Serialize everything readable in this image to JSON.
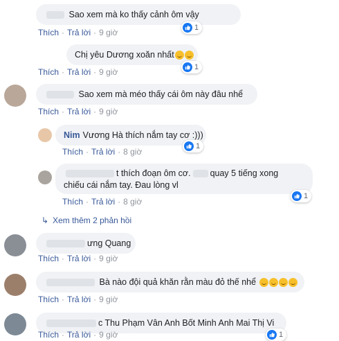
{
  "actions": {
    "like": "Thích",
    "reply": "Trả lời",
    "dot": "·"
  },
  "comments": [
    {
      "text": "Sao xem mà ko thấy cảnh ôm vậy",
      "time": "9 giờ",
      "reactions": "1"
    },
    {
      "text": "Chị yêu Dương xoăn nhất",
      "time": "9 giờ",
      "reactions": "1"
    },
    {
      "text": "Sao xem mà méo thấy cái ôm này đâu nhể",
      "time": "9 giờ",
      "reactions": ""
    },
    {
      "name": "Nim",
      "text": "Vương Hà thích nắm tay cơ :)))",
      "time": "8 giờ",
      "reactions": "1"
    },
    {
      "text_a": "t thích đoạn ôm cơ.",
      "text_b": "quay 5 tiếng xong",
      "text_c": "chiếu cái nắm tay. Đau lòng vl",
      "time": "8 giờ",
      "reactions": "1"
    },
    {
      "text": "ưng Quang",
      "time": "9 giờ",
      "reactions": ""
    },
    {
      "text": "Bà nào đội quả khăn rằn màu đỏ thế nhể",
      "time": "9 giờ",
      "reactions": ""
    },
    {
      "text": "c Thu Phạm Vân Anh Bốt Minh Anh Mai Thị Vi",
      "time": "9 giờ",
      "reactions": "1"
    }
  ],
  "see_more": "Xem thêm 2 phản hồi",
  "colors": {
    "link": "#385898",
    "bubble": "#f0f2f5",
    "like": "#1877f2"
  }
}
